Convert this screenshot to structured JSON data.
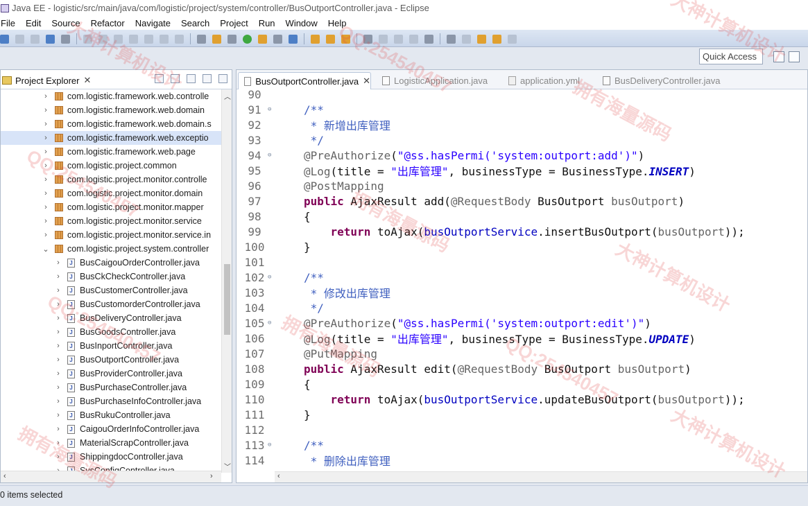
{
  "window": {
    "title": "Java EE - logistic/src/main/java/com/logistic/project/system/controller/BusOutportController.java - Eclipse"
  },
  "menu": [
    "File",
    "Edit",
    "Source",
    "Refactor",
    "Navigate",
    "Search",
    "Project",
    "Run",
    "Window",
    "Help"
  ],
  "toolbar": {
    "quick_access": "Quick Access"
  },
  "project_explorer": {
    "title": "Project Explorer",
    "close": "✕",
    "items": [
      {
        "type": "package",
        "label": "com.logistic.framework.web.controlle",
        "expanded": false
      },
      {
        "type": "package",
        "label": "com.logistic.framework.web.domain",
        "expanded": false
      },
      {
        "type": "package",
        "label": "com.logistic.framework.web.domain.s",
        "expanded": false
      },
      {
        "type": "package",
        "label": "com.logistic.framework.web.exceptio",
        "expanded": false
      },
      {
        "type": "package",
        "label": "com.logistic.framework.web.page",
        "expanded": false
      },
      {
        "type": "package",
        "label": "com.logistic.project.common",
        "expanded": false
      },
      {
        "type": "package",
        "label": "com.logistic.project.monitor.controlle",
        "expanded": false
      },
      {
        "type": "package",
        "label": "com.logistic.project.monitor.domain",
        "expanded": false
      },
      {
        "type": "package",
        "label": "com.logistic.project.monitor.mapper",
        "expanded": false
      },
      {
        "type": "package",
        "label": "com.logistic.project.monitor.service",
        "expanded": false
      },
      {
        "type": "package",
        "label": "com.logistic.project.monitor.service.in",
        "expanded": false
      },
      {
        "type": "package",
        "label": "com.logistic.project.system.controller",
        "expanded": true
      },
      {
        "type": "file",
        "label": "BusCaigouOrderController.java"
      },
      {
        "type": "file",
        "label": "BusCkCheckController.java"
      },
      {
        "type": "file",
        "label": "BusCustomerController.java"
      },
      {
        "type": "file",
        "label": "BusCustomorderController.java"
      },
      {
        "type": "file",
        "label": "BusDeliveryController.java"
      },
      {
        "type": "file",
        "label": "BusGoodsController.java"
      },
      {
        "type": "file",
        "label": "BusInportController.java"
      },
      {
        "type": "file",
        "label": "BusOutportController.java"
      },
      {
        "type": "file",
        "label": "BusProviderController.java"
      },
      {
        "type": "file",
        "label": "BusPurchaseController.java"
      },
      {
        "type": "file",
        "label": "BusPurchaseInfoController.java"
      },
      {
        "type": "file",
        "label": "BusRukuController.java"
      },
      {
        "type": "file",
        "label": "CaigouOrderInfoController.java"
      },
      {
        "type": "file",
        "label": "MaterialScrapController.java"
      },
      {
        "type": "file",
        "label": "ShippingdocController.java"
      },
      {
        "type": "file",
        "label": "SysConfigController.java"
      }
    ]
  },
  "editor": {
    "tabs": [
      {
        "label": "BusOutportController.java",
        "active": true,
        "close": "✕"
      },
      {
        "label": "LogisticApplication.java",
        "active": false
      },
      {
        "label": "application.yml",
        "active": false
      },
      {
        "label": "BusDeliveryController.java",
        "active": false
      }
    ],
    "code_lines": [
      {
        "n": "90",
        "fold": "",
        "tokens": []
      },
      {
        "n": "91",
        "fold": "⊖",
        "tokens": [
          {
            "t": "/**",
            "c": "cmt"
          }
        ]
      },
      {
        "n": "92",
        "fold": "",
        "tokens": [
          {
            "t": " * 新增出库管理",
            "c": "cmt"
          }
        ]
      },
      {
        "n": "93",
        "fold": "",
        "tokens": [
          {
            "t": " */",
            "c": "cmt"
          }
        ]
      },
      {
        "n": "94",
        "fold": "⊖",
        "tokens": [
          {
            "t": "@PreAuthorize",
            "c": "ann"
          },
          {
            "t": "(",
            "c": ""
          },
          {
            "t": "\"@ss.hasPermi('system:outport:add')\"",
            "c": "str"
          },
          {
            "t": ")",
            "c": ""
          }
        ]
      },
      {
        "n": "95",
        "fold": "",
        "tokens": [
          {
            "t": "@Log",
            "c": "ann"
          },
          {
            "t": "(title = ",
            "c": ""
          },
          {
            "t": "\"出库管理\"",
            "c": "str"
          },
          {
            "t": ", businessType = BusinessType.",
            "c": ""
          },
          {
            "t": "INSERT",
            "c": "cst"
          },
          {
            "t": ")",
            "c": ""
          }
        ]
      },
      {
        "n": "96",
        "fold": "",
        "tokens": [
          {
            "t": "@PostMapping",
            "c": "ann"
          }
        ]
      },
      {
        "n": "97",
        "fold": "",
        "tokens": [
          {
            "t": "public",
            "c": "kw"
          },
          {
            "t": " AjaxResult add(",
            "c": ""
          },
          {
            "t": "@RequestBody",
            "c": "ann"
          },
          {
            "t": " BusOutport ",
            "c": ""
          },
          {
            "t": "busOutport",
            "c": "ann"
          },
          {
            "t": ")",
            "c": ""
          }
        ]
      },
      {
        "n": "98",
        "fold": "",
        "tokens": [
          {
            "t": "{",
            "c": ""
          }
        ]
      },
      {
        "n": "99",
        "fold": "",
        "tokens": [
          {
            "t": "    ",
            "c": ""
          },
          {
            "t": "return",
            "c": "kw"
          },
          {
            "t": " toAjax(",
            "c": ""
          },
          {
            "t": "busOutportService",
            "c": "fld"
          },
          {
            "t": ".insertBusOutport(",
            "c": ""
          },
          {
            "t": "busOutport",
            "c": "ann"
          },
          {
            "t": "));",
            "c": ""
          }
        ]
      },
      {
        "n": "100",
        "fold": "",
        "tokens": [
          {
            "t": "}",
            "c": ""
          }
        ]
      },
      {
        "n": "101",
        "fold": "",
        "tokens": []
      },
      {
        "n": "102",
        "fold": "⊖",
        "tokens": [
          {
            "t": "/**",
            "c": "cmt"
          }
        ]
      },
      {
        "n": "103",
        "fold": "",
        "tokens": [
          {
            "t": " * 修改出库管理",
            "c": "cmt"
          }
        ]
      },
      {
        "n": "104",
        "fold": "",
        "tokens": [
          {
            "t": " */",
            "c": "cmt"
          }
        ]
      },
      {
        "n": "105",
        "fold": "⊖",
        "tokens": [
          {
            "t": "@PreAuthorize",
            "c": "ann"
          },
          {
            "t": "(",
            "c": ""
          },
          {
            "t": "\"@ss.hasPermi('system:outport:edit')\"",
            "c": "str"
          },
          {
            "t": ")",
            "c": ""
          }
        ]
      },
      {
        "n": "106",
        "fold": "",
        "tokens": [
          {
            "t": "@Log",
            "c": "ann"
          },
          {
            "t": "(title = ",
            "c": ""
          },
          {
            "t": "\"出库管理\"",
            "c": "str"
          },
          {
            "t": ", businessType = BusinessType.",
            "c": ""
          },
          {
            "t": "UPDATE",
            "c": "cst"
          },
          {
            "t": ")",
            "c": ""
          }
        ]
      },
      {
        "n": "107",
        "fold": "",
        "tokens": [
          {
            "t": "@PutMapping",
            "c": "ann"
          }
        ]
      },
      {
        "n": "108",
        "fold": "",
        "tokens": [
          {
            "t": "public",
            "c": "kw"
          },
          {
            "t": " AjaxResult edit(",
            "c": ""
          },
          {
            "t": "@RequestBody",
            "c": "ann"
          },
          {
            "t": " BusOutport ",
            "c": ""
          },
          {
            "t": "busOutport",
            "c": "ann"
          },
          {
            "t": ")",
            "c": ""
          }
        ]
      },
      {
        "n": "109",
        "fold": "",
        "tokens": [
          {
            "t": "{",
            "c": ""
          }
        ]
      },
      {
        "n": "110",
        "fold": "",
        "tokens": [
          {
            "t": "    ",
            "c": ""
          },
          {
            "t": "return",
            "c": "kw"
          },
          {
            "t": " toAjax(",
            "c": ""
          },
          {
            "t": "busOutportService",
            "c": "fld"
          },
          {
            "t": ".updateBusOutport(",
            "c": ""
          },
          {
            "t": "busOutport",
            "c": "ann"
          },
          {
            "t": "));",
            "c": ""
          }
        ]
      },
      {
        "n": "111",
        "fold": "",
        "tokens": [
          {
            "t": "}",
            "c": ""
          }
        ]
      },
      {
        "n": "112",
        "fold": "",
        "tokens": []
      },
      {
        "n": "113",
        "fold": "⊖",
        "tokens": [
          {
            "t": "/**",
            "c": "cmt"
          }
        ]
      },
      {
        "n": "114",
        "fold": "",
        "tokens": [
          {
            "t": " * 删除出库管理",
            "c": "cmt"
          }
        ]
      }
    ]
  },
  "status": {
    "text": "0 items selected"
  },
  "watermarks": [
    "大神计算机设计",
    "QQ:254540457",
    "拥有海量源码",
    "大神计算机设计",
    "QQ:254540457",
    "拥有海量源码",
    "大神计算机设计",
    "QQ:254540457",
    "拥有海量源码",
    "QQ:254540457",
    "大神计算机设计",
    "拥有海量源码"
  ]
}
